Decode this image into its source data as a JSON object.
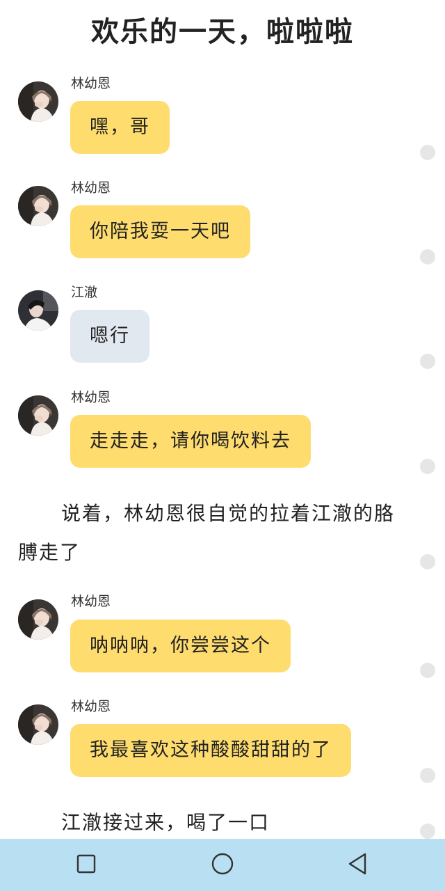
{
  "title": "欢乐的一天，啦啦啦",
  "colors": {
    "bubble_primary": "#fedc6e",
    "bubble_secondary": "#e2e8ef",
    "nav_bar": "#b8dff2",
    "scroll_dot": "#e6e6e6"
  },
  "messages": [
    {
      "sender": "林幼恩",
      "text": "嘿，哥",
      "style": "yellow",
      "avatar": "girl-avatar"
    },
    {
      "sender": "林幼恩",
      "text": "你陪我耍一天吧",
      "style": "yellow",
      "avatar": "girl-avatar"
    },
    {
      "sender": "江澈",
      "text": "嗯行",
      "style": "gray",
      "avatar": "boy-avatar"
    },
    {
      "sender": "林幼恩",
      "text": "走走走，请你喝饮料去",
      "style": "yellow",
      "avatar": "girl-avatar"
    },
    {
      "sender": "林幼恩",
      "text": "呐呐呐，你尝尝这个",
      "style": "yellow",
      "avatar": "girl-avatar"
    },
    {
      "sender": "林幼恩",
      "text": "我最喜欢这种酸酸甜甜的了",
      "style": "yellow",
      "avatar": "girl-avatar"
    }
  ],
  "narrations": [
    "说着，林幼恩很自觉的拉着江澈的胳膊走了",
    "江澈接过来，喝了一口"
  ],
  "nav": {
    "recents_icon": "square-icon",
    "home_icon": "circle-icon",
    "back_icon": "triangle-back-icon"
  }
}
